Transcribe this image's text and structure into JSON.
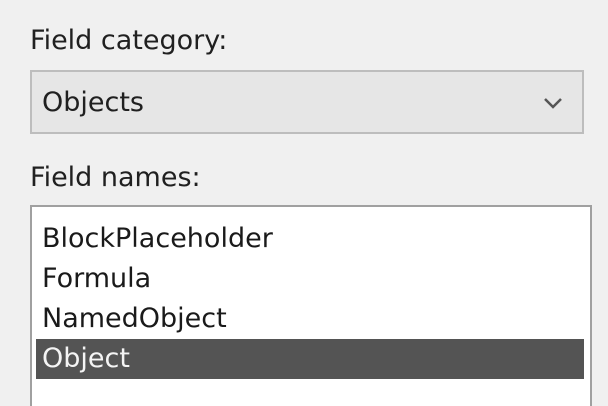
{
  "field_category": {
    "label": "Field category:",
    "selected": "Objects"
  },
  "field_names": {
    "label": "Field names:",
    "items": [
      {
        "label": "BlockPlaceholder",
        "selected": false
      },
      {
        "label": "Formula",
        "selected": false
      },
      {
        "label": "NamedObject",
        "selected": false
      },
      {
        "label": "Object",
        "selected": true
      }
    ]
  },
  "icons": {
    "dropdown_chevron": "chevron-down-icon"
  },
  "colors": {
    "selection_background": "#545454",
    "selection_text": "#f4f4f4",
    "panel_background": "#f0f0f0"
  }
}
